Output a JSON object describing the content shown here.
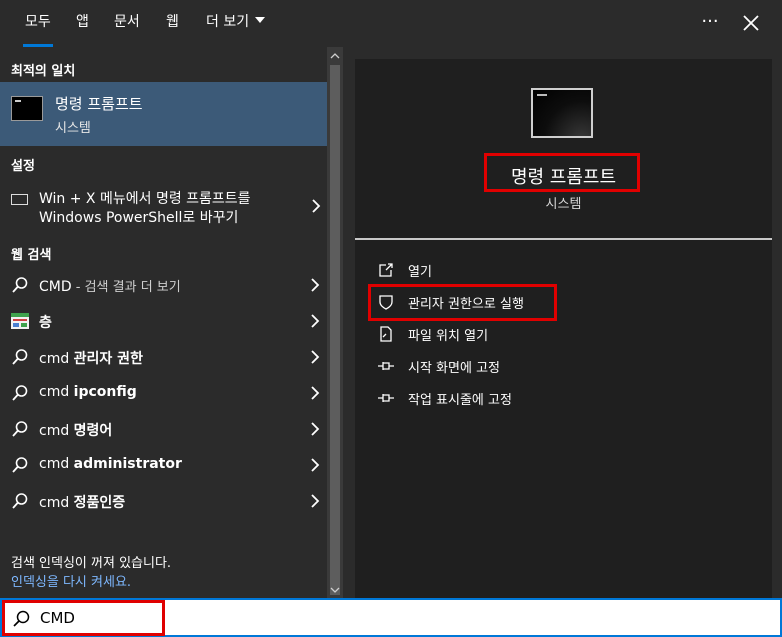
{
  "tabs": [
    {
      "label": "모두",
      "active": true
    },
    {
      "label": "앱",
      "active": false
    },
    {
      "label": "문서",
      "active": false
    },
    {
      "label": "웹",
      "active": false
    },
    {
      "label": "더 보기",
      "active": false
    }
  ],
  "topbar": {
    "ellipsis": "···",
    "close_icon": "close-icon"
  },
  "best_match": {
    "header": "최적의 일치",
    "title": "명령 프롬프트",
    "subtitle": "시스템"
  },
  "settings": {
    "header": "설정",
    "line1": "Win + X 메뉴에서 명령 프롬프트를",
    "line2": "Windows PowerShell로 바꾸기"
  },
  "web_search": {
    "header": "웹 검색",
    "items": [
      {
        "prefix": "CMD",
        "bold": "",
        "suffix": " - 검색 결과 더 보기",
        "icon": "search-icon"
      },
      {
        "prefix": "",
        "bold": "층",
        "suffix": "",
        "icon": "image-thumbnail-icon"
      },
      {
        "prefix": "cmd ",
        "bold": "관리자 권한",
        "suffix": "",
        "icon": "search-icon"
      },
      {
        "prefix": "cmd ",
        "bold": "ipconfig",
        "suffix": "",
        "icon": "search-icon"
      },
      {
        "prefix": "cmd ",
        "bold": "명령어",
        "suffix": "",
        "icon": "search-icon"
      },
      {
        "prefix": "cmd ",
        "bold": "administrator",
        "suffix": "",
        "icon": "search-icon"
      },
      {
        "prefix": "cmd ",
        "bold": "정품인증",
        "suffix": "",
        "icon": "search-icon"
      }
    ]
  },
  "index_status": {
    "line1": "검색 인덱싱이 꺼져 있습니다.",
    "link": "인덱싱을 다시 켜세요."
  },
  "preview": {
    "title": "명령 프롬프트",
    "subtitle": "시스템",
    "actions": [
      {
        "label": "열기",
        "icon": "open-icon"
      },
      {
        "label": "관리자 권한으로 실행",
        "icon": "shield-icon"
      },
      {
        "label": "파일 위치 열기",
        "icon": "file-location-icon"
      },
      {
        "label": "시작 화면에 고정",
        "icon": "pin-icon"
      },
      {
        "label": "작업 표시줄에 고정",
        "icon": "pin-icon"
      }
    ]
  },
  "search": {
    "value": "CMD",
    "placeholder": ""
  },
  "colors": {
    "accent": "#0078d7",
    "selected": "#3c5a78",
    "highlight": "#e00000"
  }
}
